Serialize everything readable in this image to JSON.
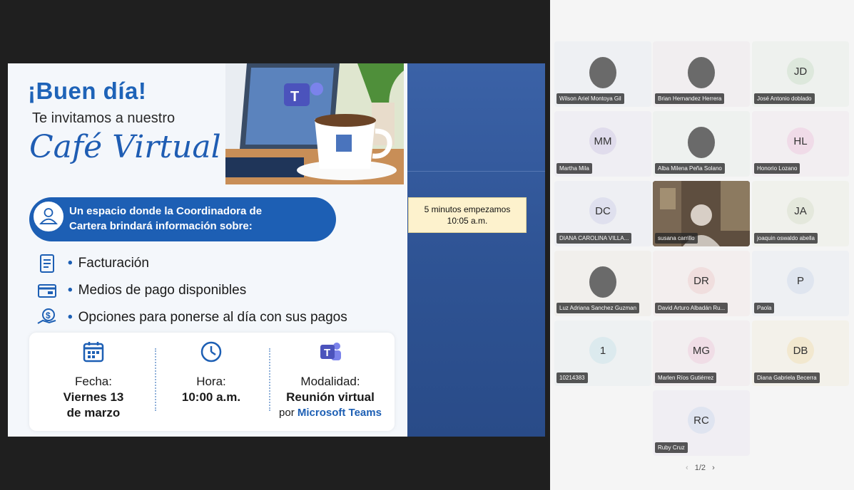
{
  "poster": {
    "greeting": "¡Buen día!",
    "invite": "Te invitamos a nuestro",
    "event_name": "Café Virtual",
    "espacio_line1": "Un espacio donde la Coordinadora de",
    "espacio_line2": "Cartera brindará información sobre:",
    "bullets": [
      {
        "label": "Facturación",
        "icon": "invoice-icon"
      },
      {
        "label": "Medios de pago disponibles",
        "icon": "card-icon"
      },
      {
        "label": "Opciones para ponerse al día con sus pagos",
        "icon": "money-hand-icon"
      }
    ],
    "fecha_label": "Fecha:",
    "fecha_value1": "Viernes 13",
    "fecha_value2": "de marzo",
    "hora_label": "Hora:",
    "hora_value": "10:00 a.m.",
    "modalidad_label": "Modalidad:",
    "modalidad_value1": "Reunión virtual",
    "modalidad_value2_pre": "por ",
    "modalidad_value2_brand": "Microsoft Teams"
  },
  "note": {
    "line1": "5 minutos empezamos",
    "line2": "10:05 a.m."
  },
  "participants": [
    {
      "name": "Wilson Ariel Montoya Gil",
      "initials": "",
      "photo": true,
      "bg": "#eef0f3"
    },
    {
      "name": "Brian Hernandez Herrera",
      "initials": "",
      "photo": true,
      "bg": "#f1eef0"
    },
    {
      "name": "José Antonio doblado",
      "initials": "JD",
      "photo": false,
      "bg": "#eef1ee",
      "avatar": "#dde8dc"
    },
    {
      "name": "Martha Mila",
      "initials": "MM",
      "photo": false,
      "bg": "#efeef3",
      "avatar": "#e0dcec"
    },
    {
      "name": "Alba Milena Peña Solano",
      "initials": "",
      "photo": true,
      "bg": "#eef1ef"
    },
    {
      "name": "Honorio Lozano",
      "initials": "HL",
      "photo": false,
      "bg": "#f2eef1",
      "avatar": "#f0dbe8"
    },
    {
      "name": "DIANA CAROLINA VILLA...",
      "initials": "DC",
      "photo": false,
      "bg": "#eeeff3",
      "avatar": "#dfe0ee"
    },
    {
      "name": "susana carrillo",
      "initials": "",
      "photo": false,
      "video": true,
      "bg": "#6b5b4b"
    },
    {
      "name": "joaquin oswaldo abella",
      "initials": "JA",
      "photo": false,
      "bg": "#f0f1ec",
      "avatar": "#e4e8dc"
    },
    {
      "name": "Luz Adriana Sanchez Guzman",
      "initials": "",
      "photo": true,
      "bg": "#f1efec"
    },
    {
      "name": "David Arturo Albadán Ru...",
      "initials": "DR",
      "photo": false,
      "bg": "#f3eeee",
      "avatar": "#f0dede"
    },
    {
      "name": "Paola",
      "initials": "P",
      "photo": false,
      "bg": "#eef0f3",
      "avatar": "#dfe5ef"
    },
    {
      "name": "10214383",
      "initials": "1",
      "photo": false,
      "bg": "#eef1f2",
      "avatar": "#dceaee"
    },
    {
      "name": "Marlen Ríos Gutiérrez",
      "initials": "MG",
      "photo": false,
      "bg": "#f2eef0",
      "avatar": "#f0dde6"
    },
    {
      "name": "Diana Gabriela Becerra",
      "initials": "DB",
      "photo": false,
      "bg": "#f3f1ea",
      "avatar": "#f2e8cf"
    },
    {
      "name": "Ruby Cruz",
      "initials": "RC",
      "photo": false,
      "bg": "#f0eef3",
      "avatar": "#dfe4f0"
    }
  ],
  "pager": {
    "prev": "‹",
    "label": "1/2",
    "next": "›"
  }
}
